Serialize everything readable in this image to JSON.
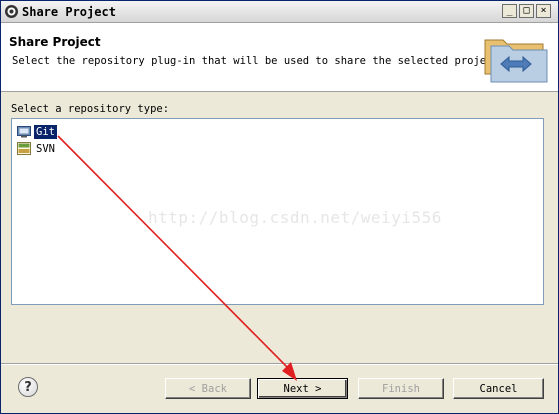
{
  "window": {
    "title": "Share Project",
    "controls": {
      "minimize": "_",
      "maximize": "□",
      "close": "×"
    }
  },
  "header": {
    "title": "Share Project",
    "description": "Select the repository plug-in that will be used to share the selected project."
  },
  "repository": {
    "label": "Select a repository type:",
    "items": [
      {
        "label": "Git",
        "icon": "git-repository-icon",
        "selected": true
      },
      {
        "label": "SVN",
        "icon": "svn-repository-icon",
        "selected": false
      }
    ]
  },
  "watermark": "http://blog.csdn.net/weiyi556",
  "footer": {
    "help": "?",
    "back_label": "< Back",
    "next_label": "Next >",
    "finish_label": "Finish",
    "cancel_label": "Cancel"
  },
  "colors": {
    "selection": "#0a246a",
    "annotation_arrow": "#e02020",
    "dialog_bg": "#ece9d8"
  }
}
